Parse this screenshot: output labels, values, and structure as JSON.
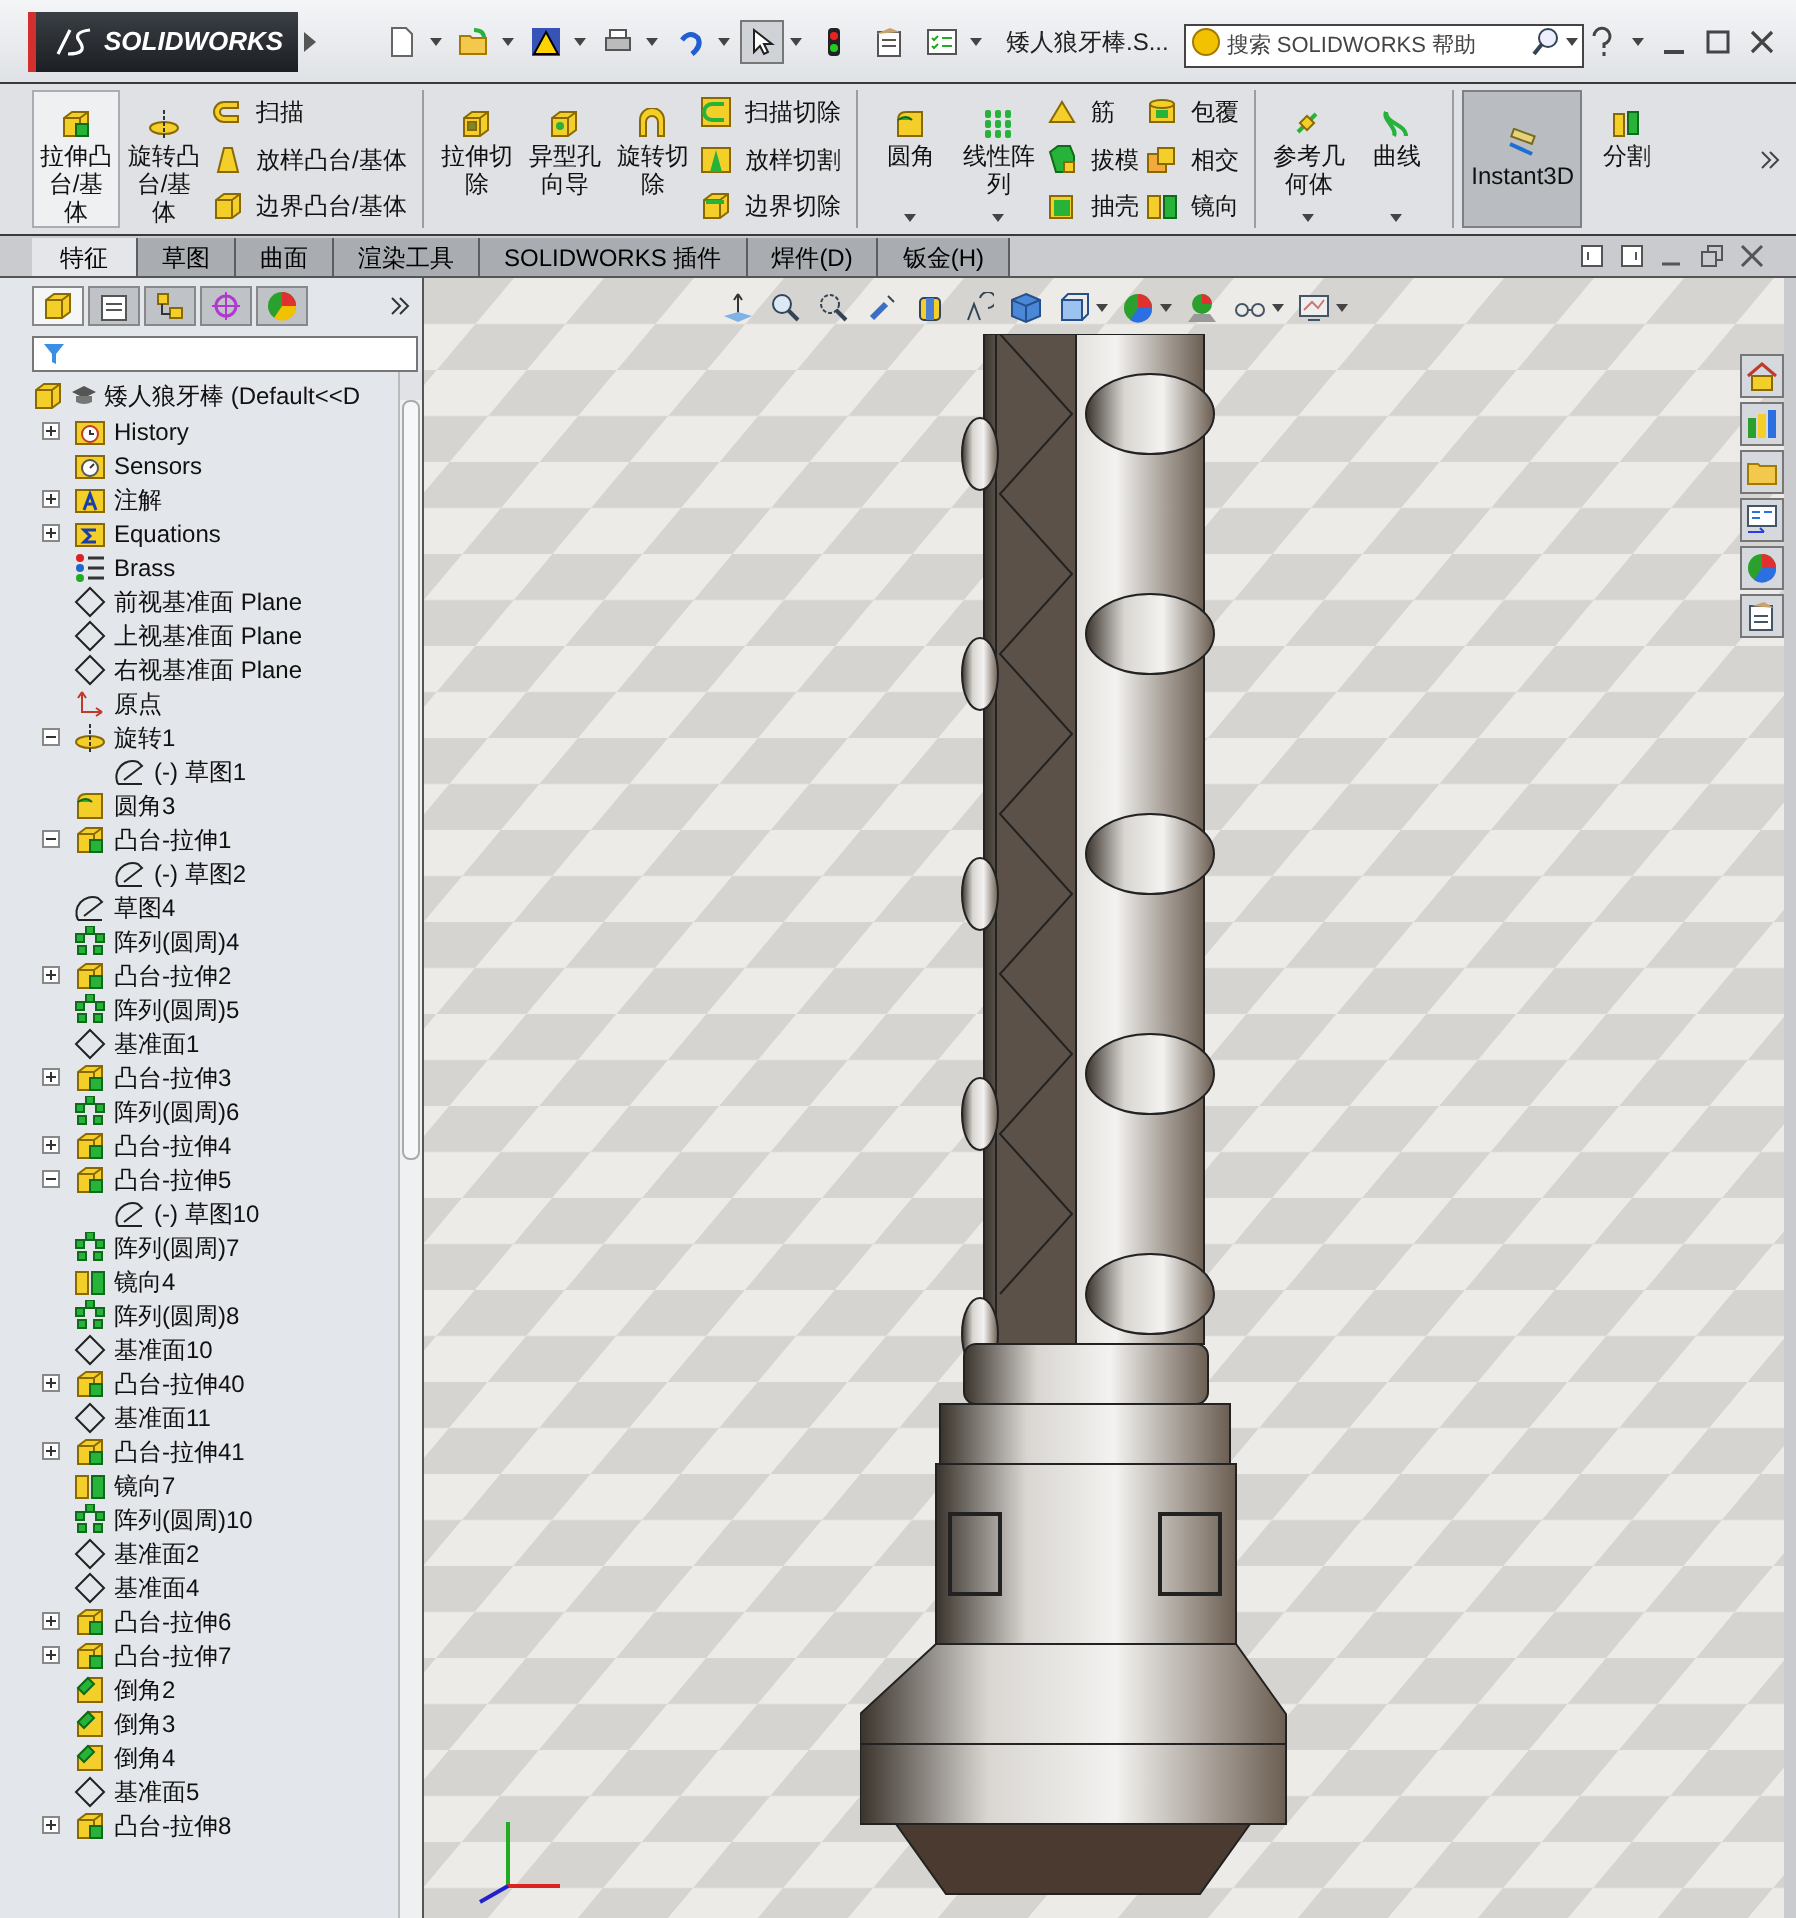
{
  "app": {
    "logo_text": "SOLIDWORKS"
  },
  "quick_access": [
    {
      "kind": "new",
      "dropdown": true,
      "selected": false
    },
    {
      "kind": "open",
      "dropdown": true,
      "selected": false
    },
    {
      "kind": "save",
      "dropdown": true,
      "selected": false
    },
    {
      "kind": "print",
      "dropdown": true,
      "selected": false
    },
    {
      "kind": "undo",
      "dropdown": true,
      "selected": false
    },
    {
      "kind": "select",
      "dropdown": true,
      "selected": true
    },
    {
      "kind": "rebuild",
      "dropdown": false,
      "selected": false
    },
    {
      "kind": "options",
      "dropdown": false,
      "selected": false
    },
    {
      "kind": "list",
      "dropdown": true,
      "selected": false
    }
  ],
  "document_title": "矮人狼牙棒.S...",
  "search": {
    "placeholder": "搜索 SOLIDWORKS 帮助"
  },
  "ribbon": [
    {
      "large": [
        {
          "label": "拉伸凸台/基体",
          "kind": "extrude",
          "highlighted": true,
          "selected": false,
          "dropdown": false
        },
        {
          "label": "旋转凸台/基体",
          "kind": "revolve",
          "highlighted": false,
          "selected": false,
          "dropdown": false
        }
      ],
      "columns": [
        [
          {
            "label": "扫描",
            "kind": "sweep"
          },
          {
            "label": "放样凸台/基体",
            "kind": "loft"
          },
          {
            "label": "边界凸台/基体",
            "kind": "boundary"
          }
        ]
      ]
    },
    {
      "large": [
        {
          "label": "拉伸切除",
          "kind": "cut-extrude",
          "highlighted": false,
          "selected": false,
          "dropdown": false
        },
        {
          "label": "异型孔向导",
          "kind": "hole",
          "highlighted": false,
          "selected": false,
          "dropdown": false
        },
        {
          "label": "旋转切除",
          "kind": "cut-revolve",
          "highlighted": false,
          "selected": false,
          "dropdown": false
        }
      ],
      "columns": [
        [
          {
            "label": "扫描切除",
            "kind": "cut-sweep"
          },
          {
            "label": "放样切割",
            "kind": "cut-loft"
          },
          {
            "label": "边界切除",
            "kind": "cut-boundary"
          }
        ]
      ]
    },
    {
      "large": [
        {
          "label": "圆角",
          "kind": "fillet",
          "highlighted": false,
          "selected": false,
          "dropdown": true
        },
        {
          "label": "线性阵列",
          "kind": "pattern",
          "highlighted": false,
          "selected": false,
          "dropdown": true
        }
      ],
      "columns": [
        [
          {
            "label": "筋",
            "kind": "rib"
          },
          {
            "label": "拔模",
            "kind": "draft"
          },
          {
            "label": "抽壳",
            "kind": "shell"
          }
        ],
        [
          {
            "label": "包覆",
            "kind": "wrap"
          },
          {
            "label": "相交",
            "kind": "intersect"
          },
          {
            "label": "镜向",
            "kind": "mirror"
          }
        ]
      ]
    },
    {
      "large": [
        {
          "label": "参考几何体",
          "kind": "refgeom",
          "highlighted": false,
          "selected": false,
          "dropdown": true
        },
        {
          "label": "曲线",
          "kind": "curve",
          "highlighted": false,
          "selected": false,
          "dropdown": true
        }
      ]
    },
    {
      "large": [
        {
          "label": "Instant3D",
          "kind": "instant3d",
          "highlighted": false,
          "selected": true,
          "dropdown": false
        },
        {
          "label": "分割",
          "kind": "split",
          "highlighted": false,
          "selected": false,
          "dropdown": false
        }
      ]
    }
  ],
  "tabs": [
    {
      "label": "特征",
      "selected": true
    },
    {
      "label": "草图",
      "selected": false
    },
    {
      "label": "曲面",
      "selected": false
    },
    {
      "label": "渲染工具",
      "selected": false
    },
    {
      "label": "SOLIDWORKS 插件",
      "selected": false
    },
    {
      "label": "焊件(D)",
      "selected": false
    },
    {
      "label": "钣金(H)",
      "selected": false
    }
  ],
  "panel_tabs": [
    {
      "kind": "feature-tree",
      "selected": true
    },
    {
      "kind": "property",
      "selected": false
    },
    {
      "kind": "config",
      "selected": false
    },
    {
      "kind": "dimxpert",
      "selected": false
    },
    {
      "kind": "display",
      "selected": false
    }
  ],
  "tree": {
    "root": "矮人狼牙棒 (Default<<D",
    "items": [
      {
        "label": "History",
        "kind": "history",
        "expanded": false
      },
      {
        "label": "Sensors",
        "kind": "sensors"
      },
      {
        "label": "注解",
        "kind": "annotations",
        "expanded": false
      },
      {
        "label": "Equations",
        "kind": "equations",
        "expanded": false
      },
      {
        "label": "Brass",
        "kind": "material"
      },
      {
        "label": "前视基准面 Plane",
        "kind": "plane"
      },
      {
        "label": "上视基准面 Plane",
        "kind": "plane"
      },
      {
        "label": "右视基准面 Plane",
        "kind": "plane"
      },
      {
        "label": "原点",
        "kind": "origin"
      },
      {
        "label": "旋转1",
        "kind": "revolve",
        "expanded": true,
        "children": [
          {
            "label": "(-) 草图1",
            "kind": "sketch"
          }
        ]
      },
      {
        "label": "圆角3",
        "kind": "fillet"
      },
      {
        "label": "凸台-拉伸1",
        "kind": "extrude",
        "expanded": true,
        "children": [
          {
            "label": "(-) 草图2",
            "kind": "sketch"
          }
        ]
      },
      {
        "label": "草图4",
        "kind": "sketch"
      },
      {
        "label": "阵列(圆周)4",
        "kind": "circ-pattern"
      },
      {
        "label": "凸台-拉伸2",
        "kind": "extrude",
        "expanded": false
      },
      {
        "label": "阵列(圆周)5",
        "kind": "circ-pattern"
      },
      {
        "label": "基准面1",
        "kind": "plane"
      },
      {
        "label": "凸台-拉伸3",
        "kind": "extrude",
        "expanded": false
      },
      {
        "label": "阵列(圆周)6",
        "kind": "circ-pattern"
      },
      {
        "label": "凸台-拉伸4",
        "kind": "extrude",
        "expanded": false
      },
      {
        "label": "凸台-拉伸5",
        "kind": "extrude",
        "expanded": true,
        "children": [
          {
            "label": "(-) 草图10",
            "kind": "sketch"
          }
        ]
      },
      {
        "label": "阵列(圆周)7",
        "kind": "circ-pattern"
      },
      {
        "label": "镜向4",
        "kind": "mirror"
      },
      {
        "label": "阵列(圆周)8",
        "kind": "circ-pattern"
      },
      {
        "label": "基准面10",
        "kind": "plane"
      },
      {
        "label": "凸台-拉伸40",
        "kind": "extrude",
        "expanded": false
      },
      {
        "label": "基准面11",
        "kind": "plane"
      },
      {
        "label": "凸台-拉伸41",
        "kind": "extrude",
        "expanded": false
      },
      {
        "label": "镜向7",
        "kind": "mirror"
      },
      {
        "label": "阵列(圆周)10",
        "kind": "circ-pattern"
      },
      {
        "label": "基准面2",
        "kind": "plane"
      },
      {
        "label": "基准面4",
        "kind": "plane"
      },
      {
        "label": "凸台-拉伸6",
        "kind": "extrude",
        "expanded": false
      },
      {
        "label": "凸台-拉伸7",
        "kind": "extrude",
        "expanded": false
      },
      {
        "label": "倒角2",
        "kind": "chamfer"
      },
      {
        "label": "倒角3",
        "kind": "chamfer"
      },
      {
        "label": "倒角4",
        "kind": "chamfer"
      },
      {
        "label": "基准面5",
        "kind": "plane"
      },
      {
        "label": "凸台-拉伸8",
        "kind": "extrude",
        "expanded": false
      }
    ]
  },
  "heads_up_toolbar": [
    {
      "kind": "zoom-fit",
      "dropdown": false
    },
    {
      "kind": "zoom-area",
      "dropdown": false
    },
    {
      "kind": "previous-view",
      "dropdown": false
    },
    {
      "kind": "section-view",
      "dropdown": false
    },
    {
      "kind": "dynamic-annotation",
      "dropdown": false
    },
    {
      "kind": "view-orientation",
      "dropdown": false
    },
    {
      "kind": "display-style",
      "dropdown": false
    },
    {
      "kind": "hide-show",
      "dropdown": true
    },
    {
      "kind": "appearance",
      "dropdown": true
    },
    {
      "kind": "scene",
      "dropdown": false
    },
    {
      "kind": "view-settings",
      "dropdown": true
    },
    {
      "kind": "monitor",
      "dropdown": true
    }
  ],
  "task_pane": [
    {
      "kind": "home"
    },
    {
      "kind": "library"
    },
    {
      "kind": "folder"
    },
    {
      "kind": "palette"
    },
    {
      "kind": "appearance"
    },
    {
      "kind": "custom"
    }
  ]
}
